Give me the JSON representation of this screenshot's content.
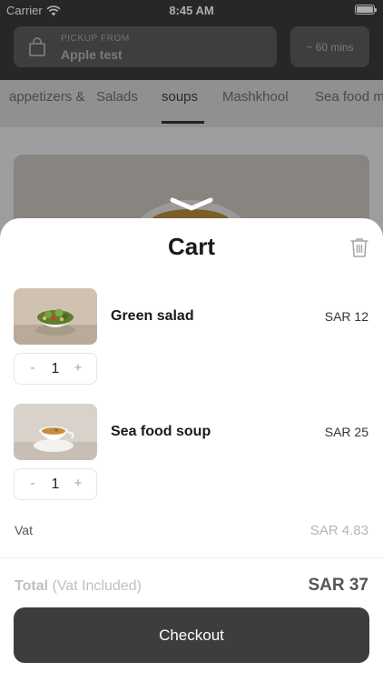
{
  "status_bar": {
    "carrier": "Carrier",
    "time": "8:45 AM"
  },
  "pickup": {
    "label": "PICKUP FROM",
    "location": "Apple test",
    "time_estimate": "~ 60 mins"
  },
  "categories": [
    {
      "label": "appetizers &"
    },
    {
      "label": "Salads"
    },
    {
      "label": "soups",
      "active": true
    },
    {
      "label": "Mashkhool"
    },
    {
      "label": "Sea food m"
    }
  ],
  "cart": {
    "title": "Cart",
    "items": [
      {
        "name": "Green salad",
        "price": "SAR 12",
        "quantity": "1",
        "minus": "-",
        "plus": "+"
      },
      {
        "name": "Sea food soup",
        "price": "SAR 25",
        "quantity": "1",
        "minus": "-",
        "plus": "+"
      }
    ],
    "vat_label": "Vat",
    "vat_value": "SAR 4.83",
    "total_label": "Total",
    "total_note": "(Vat Included)",
    "total_value": "SAR 37",
    "checkout_label": "Checkout"
  },
  "colors": {
    "dark": "#3d3d3d",
    "muted_text": "#b5b5b5",
    "sheet_bg": "#ffffff"
  },
  "icons": [
    "wifi-icon",
    "battery-icon",
    "shopping-bag-icon",
    "chevron-down-icon",
    "trash-icon"
  ]
}
